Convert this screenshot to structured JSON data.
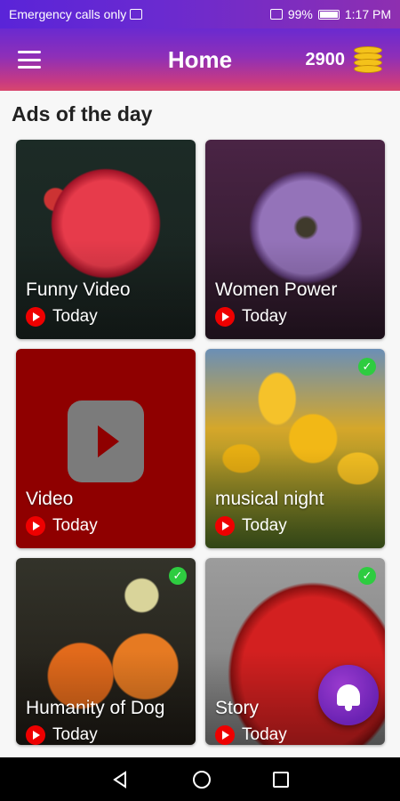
{
  "status_bar": {
    "carrier_text": "Emergency calls only",
    "battery": "99%",
    "time": "1:17 PM"
  },
  "app_bar": {
    "title": "Home",
    "coin_count": "2900",
    "menu_icon": "hamburger-icon",
    "coin_icon": "coin-stack-icon"
  },
  "section": {
    "title": "Ads of the day"
  },
  "cards": [
    {
      "title": "Funny Video",
      "when": "Today",
      "watched": false
    },
    {
      "title": "Women Power",
      "when": "Today",
      "watched": false
    },
    {
      "title": "Video",
      "when": "Today",
      "watched": false
    },
    {
      "title": "musical night",
      "when": "Today",
      "watched": true
    },
    {
      "title": "Humanity of Dog",
      "when": "Today",
      "watched": true
    },
    {
      "title": "Story",
      "when": "Today",
      "watched": true
    }
  ],
  "fab": {
    "icon": "bell-icon"
  },
  "colors": {
    "accent_purple": "#6a2ad0",
    "accent_pink": "#d8476d",
    "youtube_red": "#ee0000",
    "check_green": "#2ecc40"
  }
}
